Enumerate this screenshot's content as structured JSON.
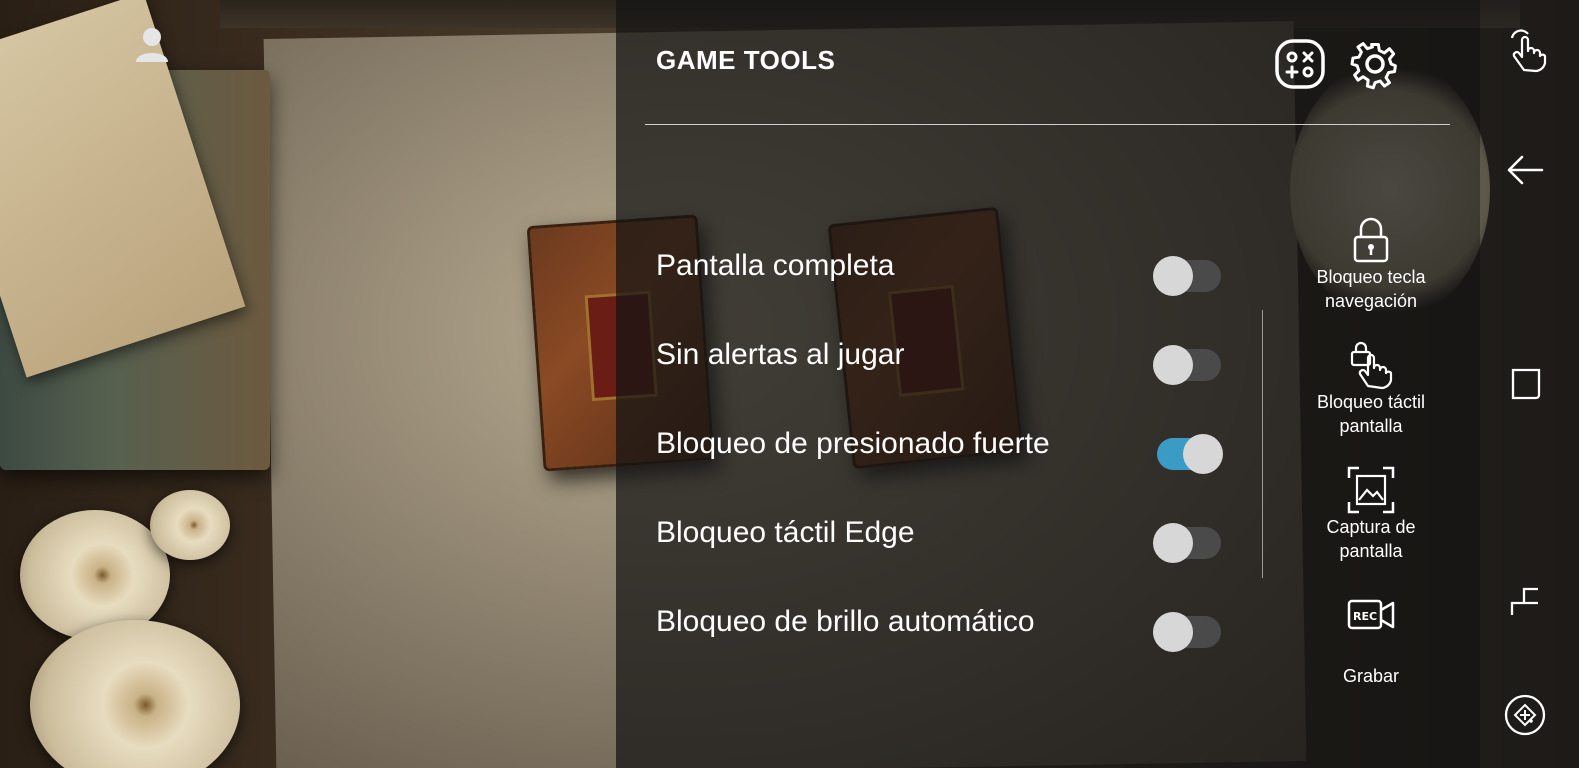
{
  "panel": {
    "title": "GAME TOOLS"
  },
  "settings": [
    {
      "label": "Pantalla completa",
      "enabled": false
    },
    {
      "label": "Sin alertas al jugar",
      "enabled": false
    },
    {
      "label": "Bloqueo de presionado fuerte",
      "enabled": true
    },
    {
      "label": "Bloqueo táctil Edge",
      "enabled": false
    },
    {
      "label": "Bloqueo de brillo automático",
      "enabled": false
    }
  ],
  "tools": [
    {
      "line1": "Bloqueo tecla",
      "line2": "navegación",
      "icon": "lock-icon"
    },
    {
      "line1": "Bloqueo táctil",
      "line2": "pantalla",
      "icon": "touch-lock-icon"
    },
    {
      "line1": "Captura de",
      "line2": "pantalla",
      "icon": "screenshot-icon"
    },
    {
      "line1": "Grabar",
      "line2": "",
      "icon": "record-icon"
    }
  ],
  "header_icons": [
    "game-launcher-icon",
    "settings-gear-icon"
  ],
  "nav_strip": [
    "touch-gesture-icon",
    "back-arrow-icon",
    "recent-apps-icon",
    "home-gesture-icon",
    "game-controller-icon"
  ],
  "colors": {
    "toggle_on": "#3a9cc4",
    "toggle_off": "#4a4a4a",
    "panel_overlay": "rgba(20,20,20,0.72)"
  }
}
